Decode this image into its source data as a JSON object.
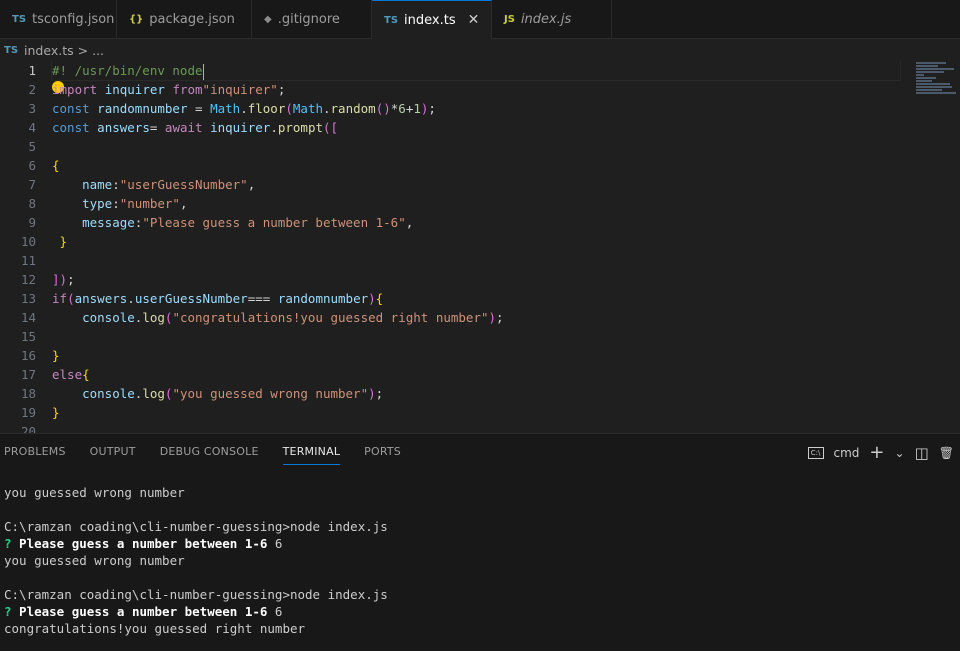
{
  "tabs": [
    {
      "icon": "TS",
      "label": "tsconfig.json",
      "active": false
    },
    {
      "icon": "{}",
      "label": "package.json",
      "active": false
    },
    {
      "icon": "◆",
      "label": ".gitignore",
      "active": false
    },
    {
      "icon": "TS",
      "label": "index.ts",
      "active": true,
      "close": "✕"
    },
    {
      "icon": "JS",
      "label": "index.js",
      "active": false
    }
  ],
  "breadcrumb": {
    "icon": "TS",
    "file": "index.ts",
    "sep": ">",
    "more": "..."
  },
  "editor": {
    "line_numbers": [
      "1",
      "2",
      "3",
      "4",
      "5",
      "6",
      "7",
      "8",
      "9",
      "10",
      "11",
      "12",
      "13",
      "14",
      "15",
      "16",
      "17",
      "18",
      "19",
      "20"
    ],
    "current_line": 1,
    "lines": [
      "#! /usr/bin/env node",
      "import inquirer from\"inquirer\";",
      "const randomnumber = Math.floor(Math.random()*6+1);",
      "const answers= await inquirer.prompt([",
      "",
      "{",
      "    name:\"userGuessNumber\",",
      "    type:\"number\",",
      "    message:\"Please guess a number between 1-6\",",
      " }",
      "",
      "]);",
      "if(answers.userGuessNumber=== randomnumber){",
      "    console.log(\"congratulations!you guessed right number\");",
      "",
      "}",
      "else{",
      "    console.log(\"you guessed wrong number\");",
      "}",
      ""
    ]
  },
  "panel": {
    "tabs": [
      "PROBLEMS",
      "OUTPUT",
      "DEBUG CONSOLE",
      "TERMINAL",
      "PORTS"
    ],
    "active_tab": "TERMINAL",
    "terminal_name": "cmd",
    "actions": {
      "add": "+",
      "dropdown": "⌄",
      "split": "◫",
      "trash": "🗑"
    }
  },
  "terminal": {
    "lines": [
      {
        "type": "plain",
        "text": "you guessed wrong number"
      },
      {
        "type": "blank",
        "text": ""
      },
      {
        "type": "plain",
        "text": "C:\\ramzan coading\\cli-number-guessing>node index.js"
      },
      {
        "type": "prompt",
        "mark": "?",
        "question": "Please guess a number between 1-6",
        "answer": "6"
      },
      {
        "type": "plain",
        "text": "you guessed wrong number"
      },
      {
        "type": "blank",
        "text": ""
      },
      {
        "type": "plain",
        "text": "C:\\ramzan coading\\cli-number-guessing>node index.js"
      },
      {
        "type": "prompt",
        "mark": "?",
        "question": "Please guess a number between 1-6",
        "answer": "6"
      },
      {
        "type": "plain",
        "text": "congratulations!you guessed right number"
      }
    ]
  }
}
